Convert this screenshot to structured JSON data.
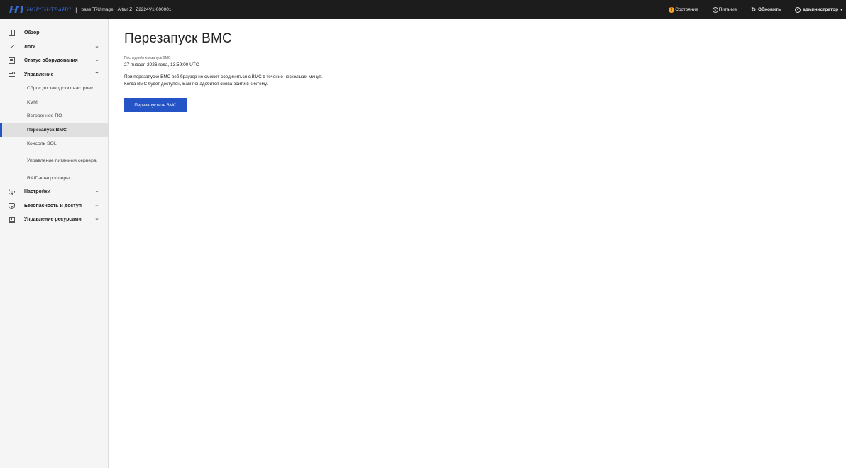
{
  "header": {
    "logo_mark": "HT",
    "logo_text": "НОРСИ-ТРАНС",
    "separator": "|",
    "host": "baseFRUimage",
    "model": "Altair Z",
    "serial": "Z2224V1-000001",
    "status_label": "Состояние",
    "status_badge": "!",
    "power_label": "Питание",
    "refresh_label": "Обновить",
    "user_label": "администратор",
    "status_color": "#f5a623"
  },
  "sidebar": {
    "items": [
      {
        "label": "Обзор",
        "icon": "grid-icon"
      },
      {
        "label": "Логи",
        "icon": "chart-icon"
      },
      {
        "label": "Статус оборудования",
        "icon": "list-icon"
      },
      {
        "label": "Управление",
        "icon": "sliders-icon"
      },
      {
        "label": "Настройки",
        "icon": "gear-icon"
      },
      {
        "label": "Безопасность и доступ",
        "icon": "shield-icon"
      },
      {
        "label": "Управление ресурсами",
        "icon": "resources-icon"
      }
    ],
    "sub_items": [
      {
        "label": "Сброс до заводских настроек"
      },
      {
        "label": "KVM"
      },
      {
        "label": "Встроенное ПО"
      },
      {
        "label": "Перезапуск BMC"
      },
      {
        "label": "Консоль SOL"
      },
      {
        "label": "Управление питанием сервера"
      },
      {
        "label": "RAID-контроллеры"
      }
    ],
    "active_color": "#2554c7"
  },
  "main": {
    "title": "Перезапуск BMC",
    "last_reboot_label": "Последний перезапуск BMC",
    "last_reboot_value": "27 января 2026 года, 13:59:00 UTC",
    "description": "При перезапуске BMC веб браузер не сможет соединиться с BMC в течение нескольких минут. Когда BMC будет доступен, Вам понадобится снова войти в систему.",
    "reboot_button": "Перезапустить BMC",
    "button_color": "#2554c7"
  }
}
